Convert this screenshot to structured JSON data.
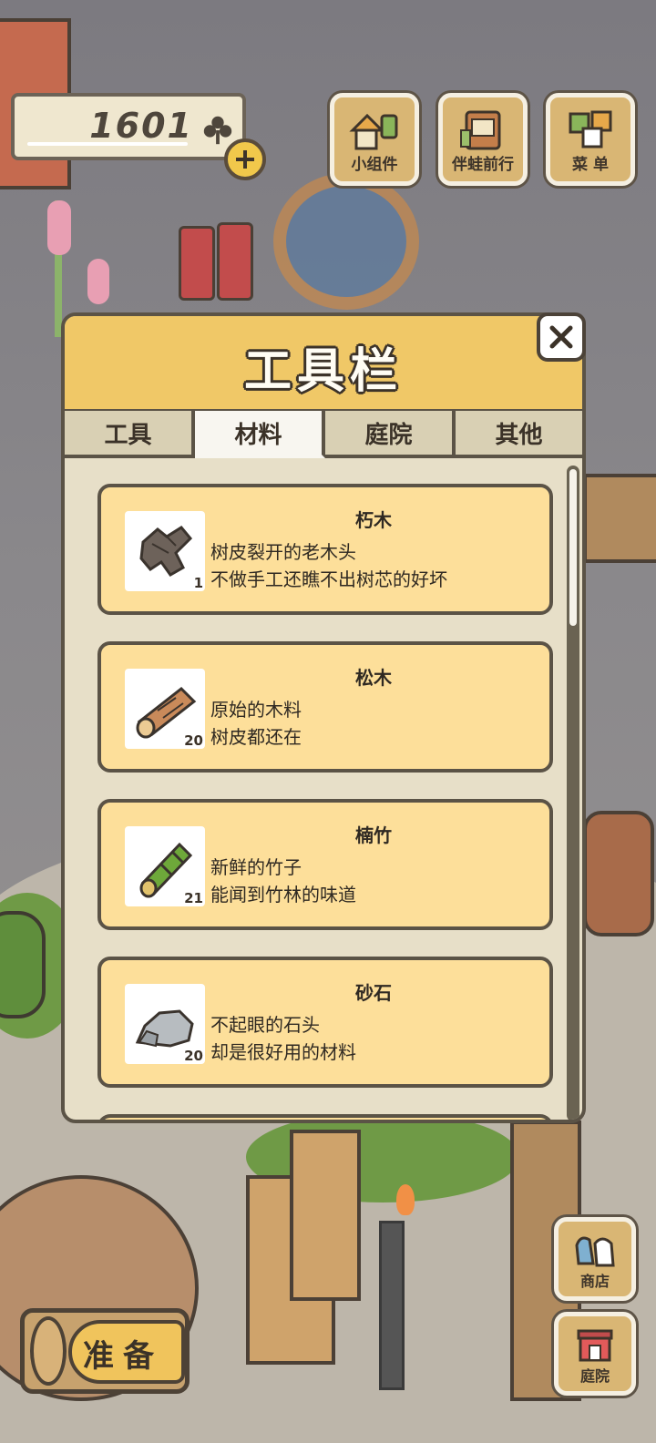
{
  "hud": {
    "clover_count": "1601",
    "buttons": [
      {
        "label": "小组件",
        "icon": "widget-icon"
      },
      {
        "label": "伴蛙前行",
        "icon": "journal-icon"
      },
      {
        "label": "菜 单",
        "icon": "menu-icon"
      }
    ]
  },
  "toolbox": {
    "title": "工具栏",
    "tabs": [
      "工具",
      "材料",
      "庭院",
      "其他"
    ],
    "active_tab": "材料",
    "items": [
      {
        "name": "朽木",
        "desc1": "树皮裂开的老木头",
        "desc2": "不做手工还瞧不出树芯的好坏",
        "qty": "1",
        "icon": "rotten-wood-icon"
      },
      {
        "name": "松木",
        "desc1": "原始的木料",
        "desc2": "树皮都还在",
        "qty": "20",
        "icon": "pine-log-icon"
      },
      {
        "name": "楠竹",
        "desc1": "新鲜的竹子",
        "desc2": "能闻到竹林的味道",
        "qty": "21",
        "icon": "bamboo-icon"
      },
      {
        "name": "砂石",
        "desc1": "不起眼的石头",
        "desc2": "却是很好用的材料",
        "qty": "20",
        "icon": "stone-icon"
      }
    ]
  },
  "bottom": {
    "prepare_label": "准备",
    "shop_label": "商店",
    "yard_label": "庭院"
  },
  "colors": {
    "panel_header": "#f0c867",
    "item_card": "#fddf9a",
    "outline": "#5b5346",
    "clover": "#4e463c"
  }
}
